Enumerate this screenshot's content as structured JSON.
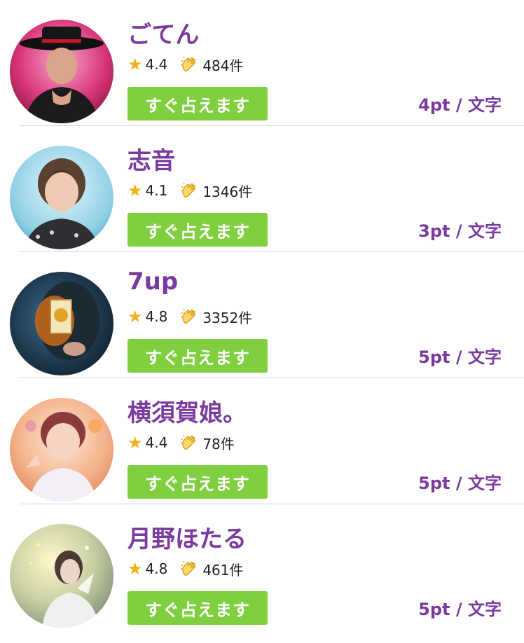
{
  "colors": {
    "name": "#7a3a9e",
    "price": "#7a3a9e",
    "button": "#7fcf3f",
    "star": "#f3b017"
  },
  "icons": {
    "rating": "star-icon",
    "reviews": "clapping-hands-icon"
  },
  "fortune_tellers": [
    {
      "name": "ごてん",
      "rating": "4.4",
      "reviews": "484件",
      "button_label": "すぐ占えます",
      "price": "4pt / 文字"
    },
    {
      "name": "志音",
      "rating": "4.1",
      "reviews": "1346件",
      "button_label": "すぐ占えます",
      "price": "3pt / 文字"
    },
    {
      "name": "7up",
      "rating": "4.8",
      "reviews": "3352件",
      "button_label": "すぐ占えます",
      "price": "5pt / 文字"
    },
    {
      "name": "横須賀娘。",
      "rating": "4.4",
      "reviews": "78件",
      "button_label": "すぐ占えます",
      "price": "5pt / 文字"
    },
    {
      "name": "月野ほたる",
      "rating": "4.8",
      "reviews": "461件",
      "button_label": "すぐ占えます",
      "price": "5pt / 文字"
    }
  ]
}
